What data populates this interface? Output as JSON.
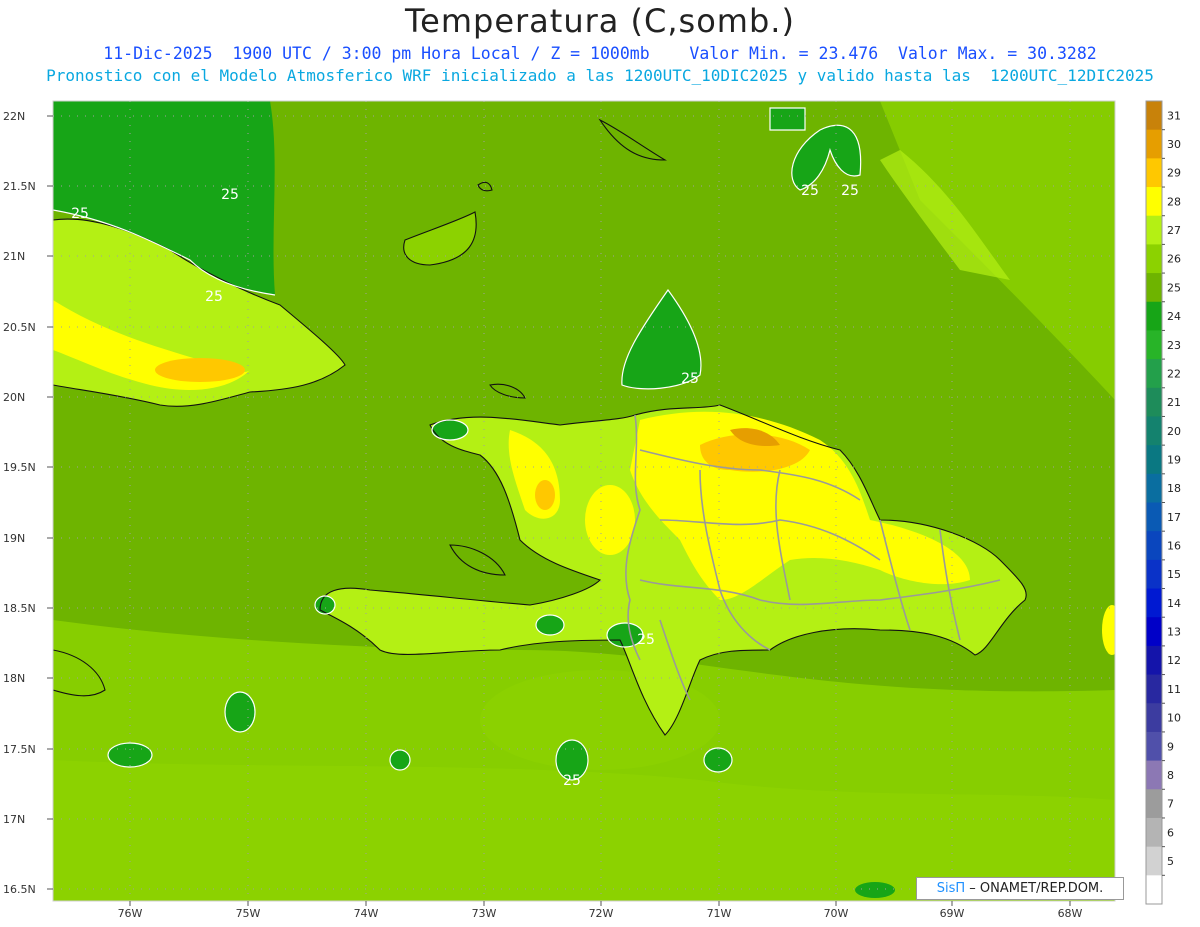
{
  "header": {
    "title": "Temperatura (C,somb.)",
    "subtitle_line1": "11-Dic-2025  1900 UTC / 3:00 pm Hora Local / Z = 1000mb    Valor Min. = 23.476  Valor Max. = 30.3282",
    "subtitle_line2": "Pronostico con el Modelo Atmosferico WRF inicializado a las 1200UTC_10DIC2025 y valido hasta las  1200UTC_12DIC2025"
  },
  "axes": {
    "lat_labels": [
      "22N",
      "21.5N",
      "21N",
      "20.5N",
      "20N",
      "19.5N",
      "19N",
      "18.5N",
      "18N",
      "17.5N",
      "17N",
      "16.5N"
    ],
    "lon_labels": [
      "76W",
      "75W",
      "74W",
      "73W",
      "72W",
      "71W",
      "70W",
      "69W",
      "68W"
    ]
  },
  "colorbar": {
    "labels": [
      "31",
      "30",
      "29",
      "28",
      "27",
      "26",
      "25",
      "24",
      "23",
      "22",
      "21",
      "20",
      "19",
      "18",
      "17",
      "16",
      "15",
      "14",
      "13",
      "12",
      "11",
      "10",
      "9",
      "8",
      "7",
      "6",
      "5"
    ],
    "colors": [
      "#c8820a",
      "#e69e00",
      "#ffc800",
      "#ffff00",
      "#b4f014",
      "#8cd200",
      "#6eb400",
      "#17a517",
      "#28b428",
      "#23a04b",
      "#1e8c5a",
      "#14826e",
      "#0a7882",
      "#0a6ea0",
      "#0a5ab4",
      "#0a46be",
      "#0a32c8",
      "#0019d2",
      "#0000c8",
      "#1414aa",
      "#2828a0",
      "#3c3ca0",
      "#5050aa",
      "#8c78b4",
      "#9c9c9c",
      "#b4b4b4",
      "#d2d2d2",
      "#ffffff"
    ]
  },
  "contour_labels": [
    "25",
    "25",
    "25",
    "25",
    "25",
    "25",
    "25",
    "25"
  ],
  "credit": {
    "brand": "SisΠ",
    "text": "– ONAMET/REP.DOM."
  },
  "colors": {
    "ocean_base": "#6eb400",
    "ocean_light": "#8cd200",
    "land_warm": "#b4f014",
    "hot_yellow": "#ffff00",
    "hot_orange": "#ffc800",
    "hot_brown": "#e69e00",
    "cool_green": "#17a517"
  }
}
